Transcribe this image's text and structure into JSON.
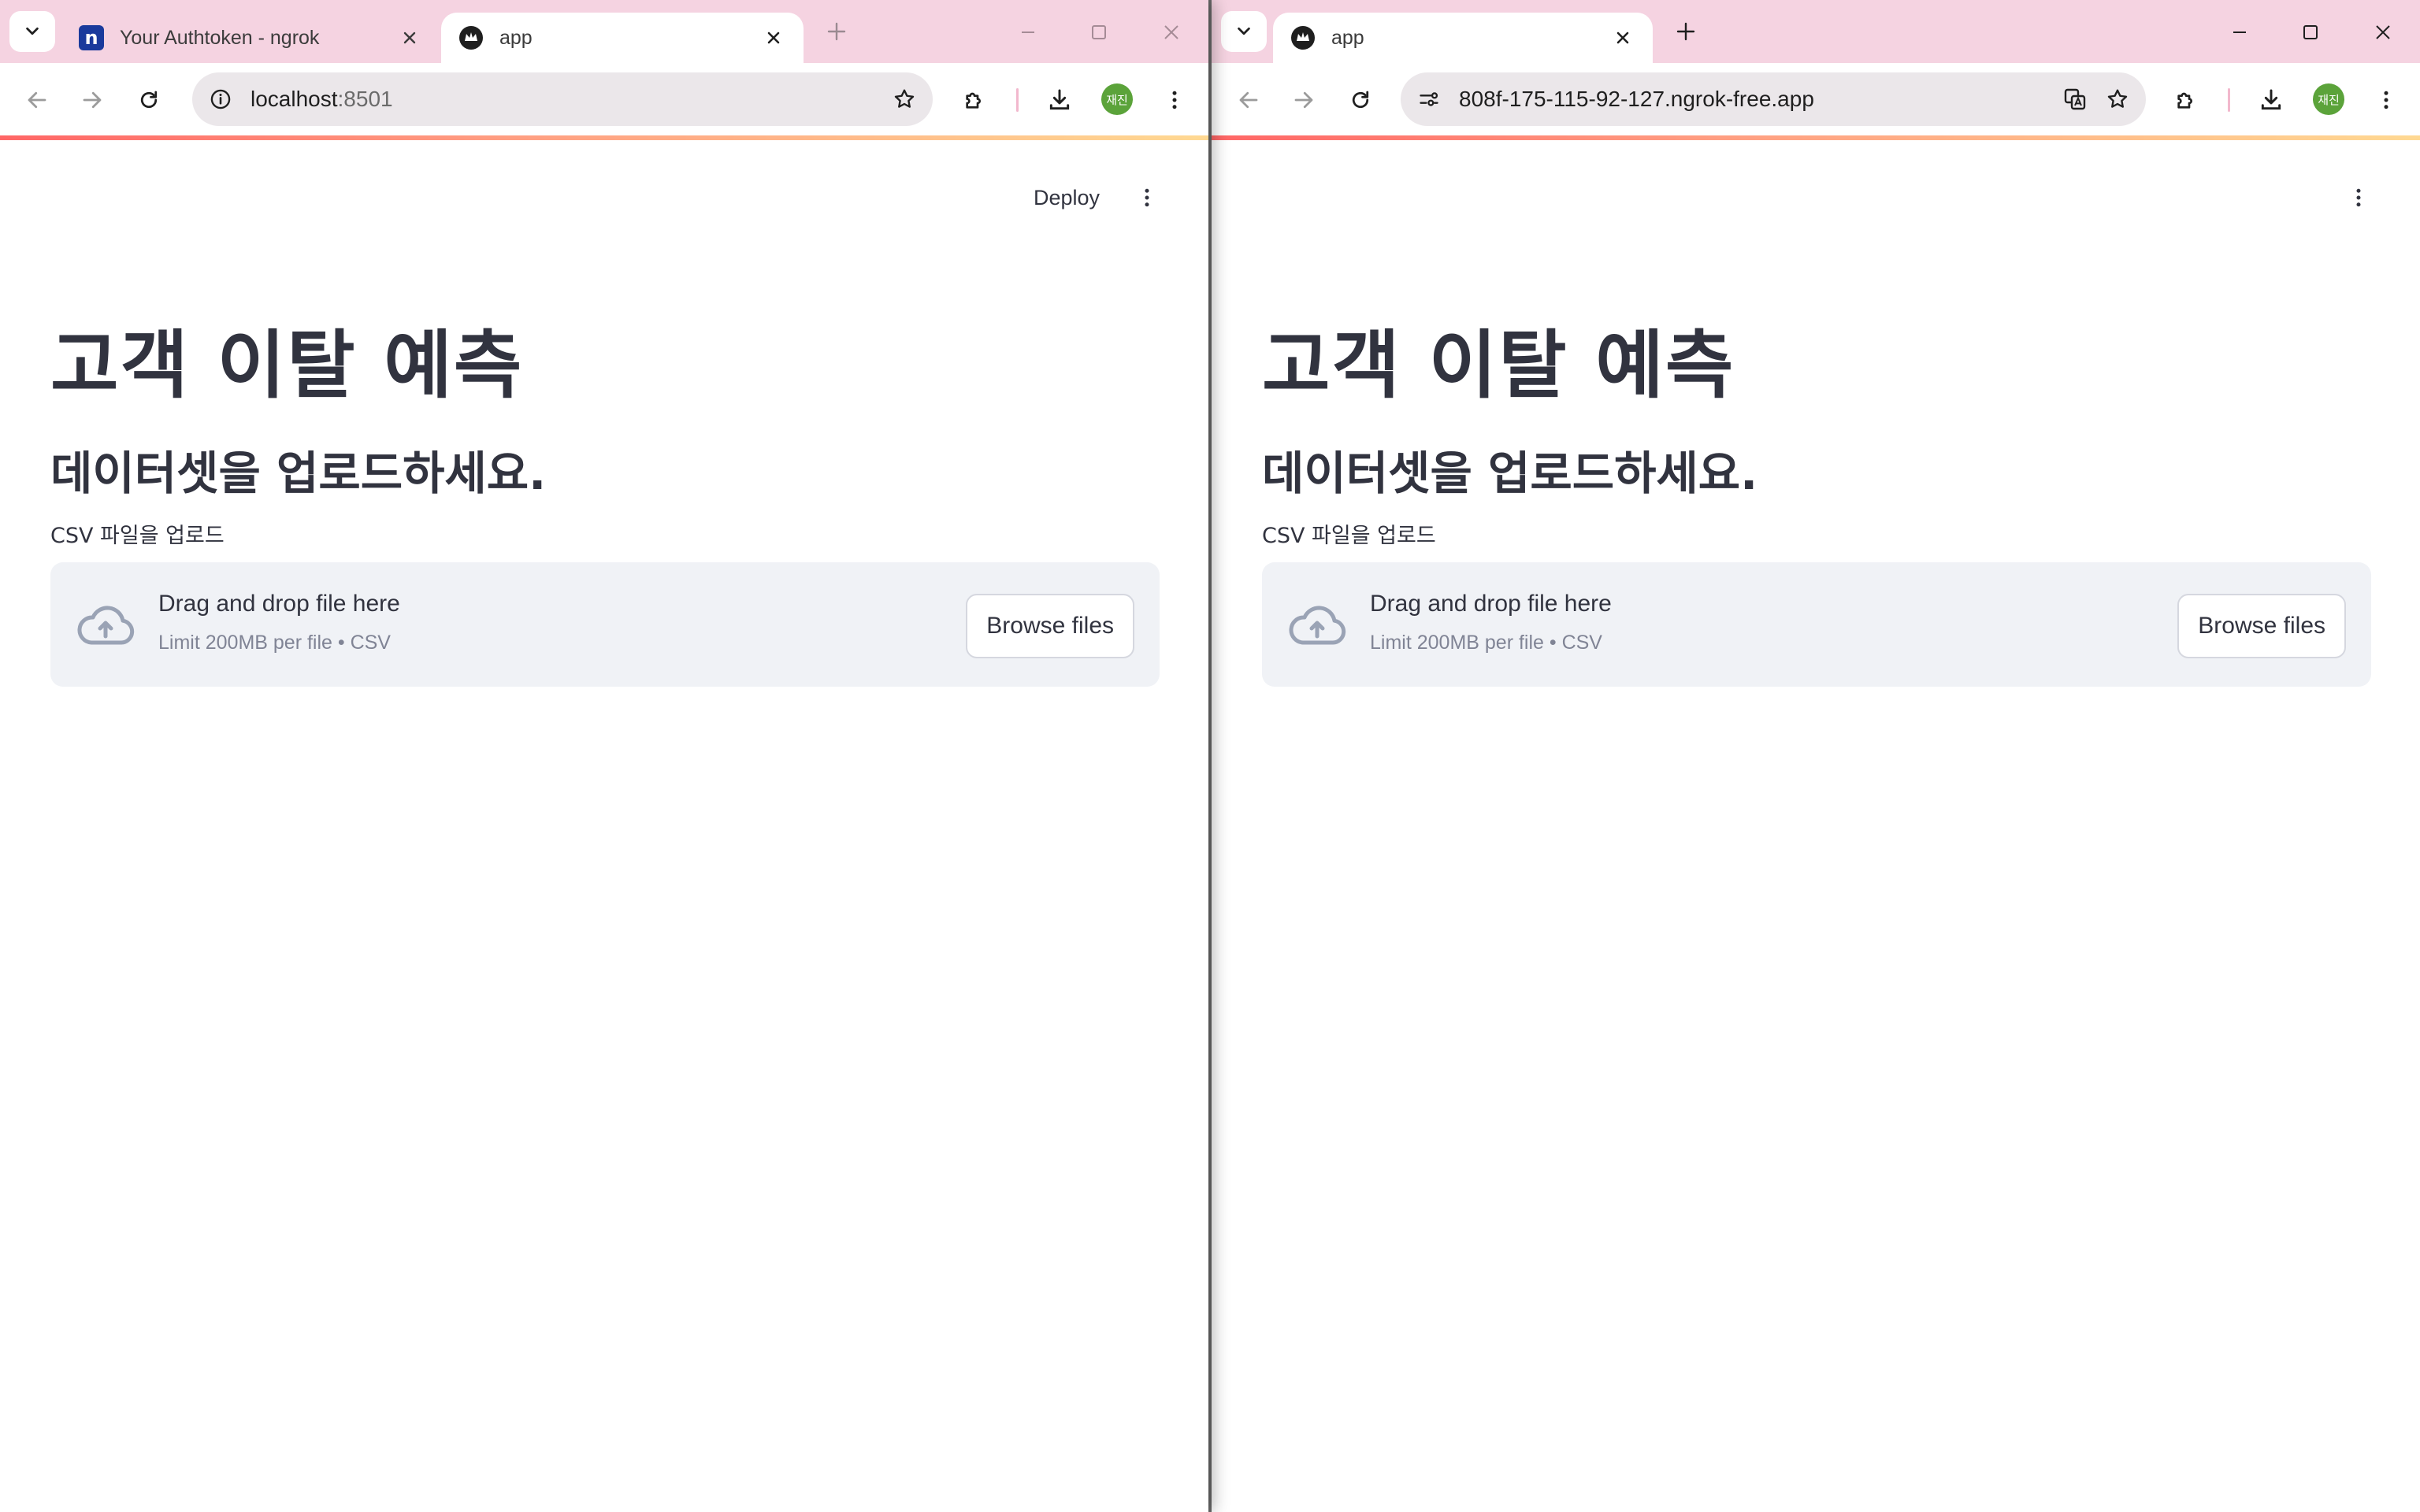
{
  "windows": [
    {
      "tabs": [
        {
          "title": "Your Authtoken - ngrok",
          "favicon": "ngrok-icon",
          "favicon_letter": "n",
          "active": false
        },
        {
          "title": "app",
          "favicon": "streamlit-crown-icon",
          "active": true
        }
      ],
      "address": {
        "host": "localhost",
        "port": ":8501"
      },
      "app": {
        "deploy_label": "Deploy",
        "title": "고객 이탈 예측",
        "subtitle": "데이터셋을 업로드하세요.",
        "uploader_label": "CSV 파일을 업로드",
        "dropzone_title": "Drag and drop file here",
        "dropzone_limit": "Limit 200MB per file • CSV",
        "browse_label": "Browse files"
      },
      "profile_initials": "재진"
    },
    {
      "tabs": [
        {
          "title": "app",
          "favicon": "streamlit-crown-icon",
          "active": true
        }
      ],
      "address": {
        "host": "808f-175-115-92-127.ngrok-free.app",
        "port": ""
      },
      "app": {
        "title": "고객 이탈 예측",
        "subtitle": "데이터셋을 업로드하세요.",
        "uploader_label": "CSV 파일을 업로드",
        "dropzone_title": "Drag and drop file here",
        "dropzone_limit": "Limit 200MB per file • CSV",
        "browse_label": "Browse files"
      },
      "profile_initials": "재진"
    }
  ],
  "colors": {
    "tabstrip": "#f5d3e1",
    "text": "#31333f",
    "dropzone": "#f0f2f6",
    "avatar": "#5ba33a",
    "accent": "#ff4b4b"
  }
}
